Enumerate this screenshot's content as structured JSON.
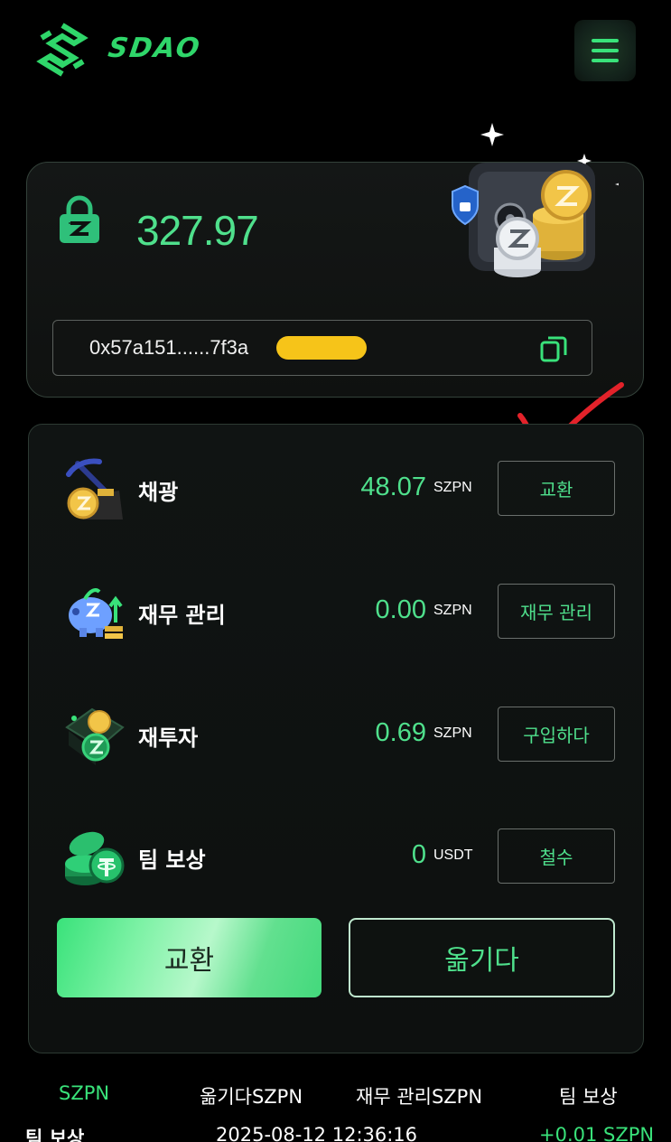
{
  "header": {
    "brand": "SDAO"
  },
  "balance_card": {
    "balance": "327.97",
    "address": "0x57a151......7f3a"
  },
  "assets": [
    {
      "label": "채광",
      "value": "48.07",
      "unit": "SZPN",
      "button": "교환",
      "icon": "mining-pickaxe-coin-icon"
    },
    {
      "label": "재무 관리",
      "value": "0.00",
      "unit": "SZPN",
      "button": "재무 관리",
      "icon": "piggy-bank-icon"
    },
    {
      "label": "재투자",
      "value": "0.69",
      "unit": "SZPN",
      "button": "구입하다",
      "icon": "wallet-coins-icon"
    },
    {
      "label": "팀 보상",
      "value": "0",
      "unit": "USDT",
      "button": "철수",
      "icon": "usdt-coins-icon"
    }
  ],
  "actions": {
    "exchange_label": "교환",
    "transfer_label": "옮기다"
  },
  "tabs": [
    {
      "label": "SZPN",
      "active": true
    },
    {
      "label": "옮기다SZPN",
      "active": false
    },
    {
      "label": "재무 관리SZPN",
      "active": false
    },
    {
      "label": "팀 보상",
      "active": false
    }
  ],
  "records": [
    {
      "type": "팀 보상",
      "time": "2025-08-12 12:36:16",
      "amount": "+0.01 SZPN"
    }
  ],
  "colors": {
    "accent": "#39e27a",
    "value_green": "#4fe08c",
    "background": "#000000",
    "redaction": "#f6c419",
    "annotation": "#e3222a"
  }
}
